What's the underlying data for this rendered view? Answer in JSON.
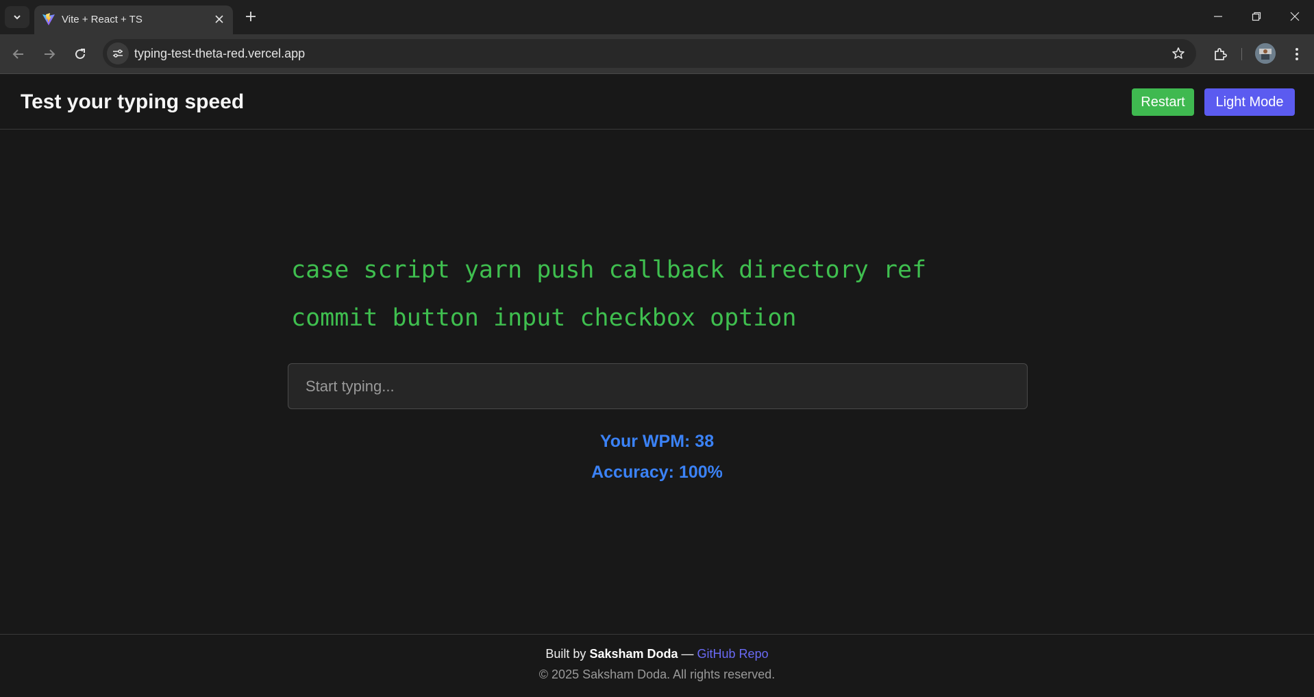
{
  "browser": {
    "tab_title": "Vite + React + TS",
    "url": "typing-test-theta-red.vercel.app"
  },
  "header": {
    "title": "Test your typing speed",
    "restart_label": "Restart",
    "theme_label": "Light Mode"
  },
  "test": {
    "words_line1": "case script yarn push callback directory ref",
    "words_line2": "commit button input checkbox option",
    "placeholder": "Start typing...",
    "wpm": "Your WPM: 38",
    "accuracy": "Accuracy: 100%"
  },
  "footer": {
    "built_by_prefix": "Built by",
    "author": "Saksham Doda",
    "dash": "—",
    "repo_link": "GitHub Repo",
    "copyright": "© 2025 Saksham Doda. All rights reserved."
  },
  "colors": {
    "words": "#3fbf4f",
    "stats": "#3b82f6",
    "restart": "#3fb950",
    "theme": "#5b5bf0"
  },
  "icons": [
    "tab-search-icon",
    "vite-favicon-icon",
    "close-icon",
    "plus-icon",
    "minimize-icon",
    "restore-icon",
    "window-close-icon",
    "back-icon",
    "forward-icon",
    "reload-icon",
    "site-info-icon",
    "star-icon",
    "extensions-icon",
    "profile-avatar",
    "menu-icon"
  ]
}
